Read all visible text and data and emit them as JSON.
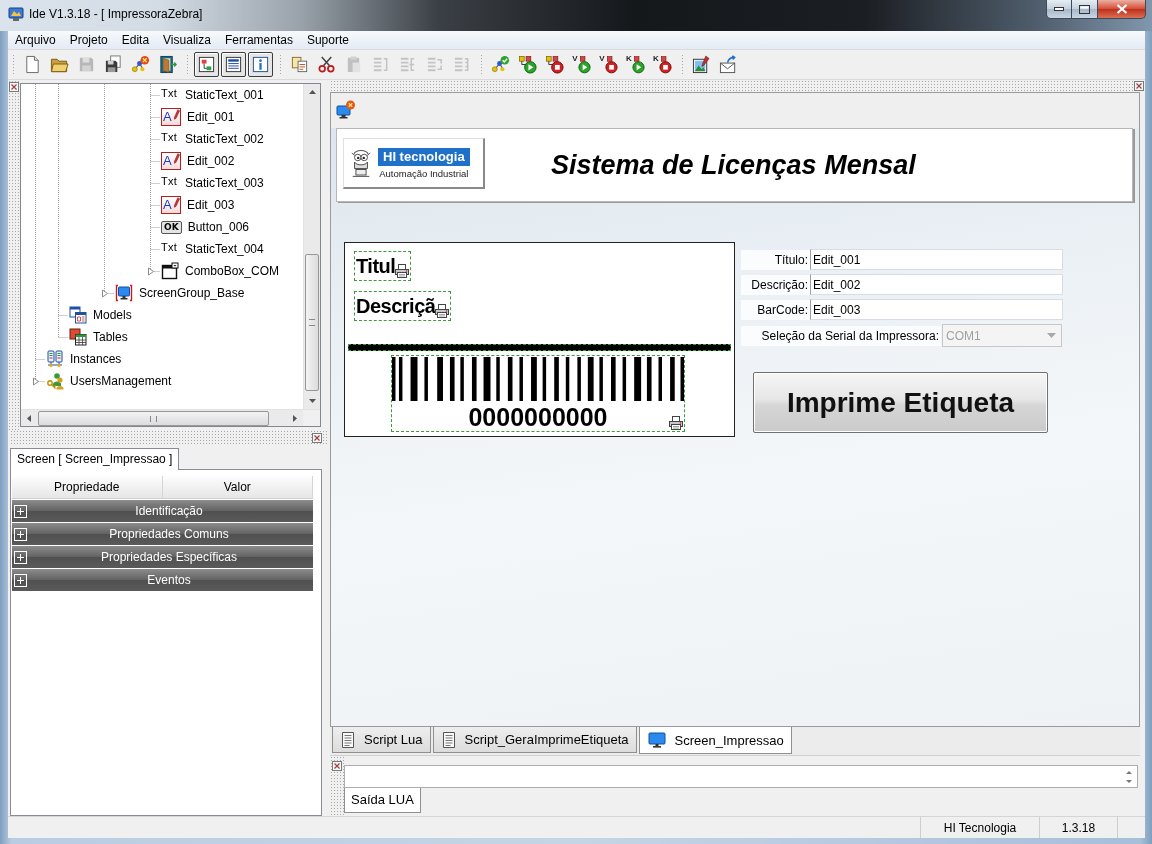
{
  "window": {
    "title": "Ide V1.3.18 - [ ImpressoraZebra]"
  },
  "menu": [
    {
      "label": "Arquivo"
    },
    {
      "label": "Projeto"
    },
    {
      "label": "Edita"
    },
    {
      "label": "Visualiza"
    },
    {
      "label": "Ferramentas"
    },
    {
      "label": "Suporte"
    }
  ],
  "toolbar": [
    {
      "buttons": [
        {
          "kind": "new",
          "disabled": false
        },
        {
          "kind": "open",
          "disabled": false
        },
        {
          "kind": "save",
          "disabled": true
        },
        {
          "kind": "save_all",
          "disabled": false
        },
        {
          "kind": "build",
          "disabled": false
        },
        {
          "kind": "exit",
          "disabled": false
        }
      ]
    },
    {
      "buttons": [
        {
          "kind": "tree_view",
          "pressed": true
        },
        {
          "kind": "list_view",
          "pressed": true
        },
        {
          "kind": "info",
          "pressed": true
        }
      ]
    },
    {
      "buttons": [
        {
          "kind": "copy",
          "disabled": false
        },
        {
          "kind": "cut",
          "disabled": false
        },
        {
          "kind": "paste",
          "disabled": true
        },
        {
          "kind": "align_a",
          "disabled": true
        },
        {
          "kind": "align_b",
          "disabled": true
        },
        {
          "kind": "align_c",
          "disabled": true
        },
        {
          "kind": "align_d",
          "disabled": true
        }
      ]
    },
    {
      "buttons": [
        {
          "kind": "check"
        },
        {
          "kind": "run"
        },
        {
          "kind": "stop"
        },
        {
          "kind": "run_mode",
          "badge": "V"
        },
        {
          "kind": "stop_mode",
          "badge": "V"
        },
        {
          "kind": "run_mode",
          "badge": "K"
        },
        {
          "kind": "stop_mode",
          "badge": "K"
        }
      ]
    },
    {
      "buttons": [
        {
          "kind": "image"
        },
        {
          "kind": "mail"
        }
      ]
    }
  ],
  "project_tree": {
    "items": [
      {
        "children": [
          {
            "children": [
              {
                "children": [
                  {
                    "children": [
                      {
                        "children": [
                          {
                            "label": "StaticText_001",
                            "kind": "static_text",
                            "icon_text": "Txt"
                          },
                          {
                            "label": "Edit_001",
                            "kind": "edit",
                            "icon_text": "A"
                          },
                          {
                            "label": "StaticText_002",
                            "kind": "static_text",
                            "icon_text": "Txt"
                          },
                          {
                            "label": "Edit_002",
                            "kind": "edit",
                            "icon_text": "A"
                          },
                          {
                            "label": "StaticText_003",
                            "kind": "static_text",
                            "icon_text": "Txt"
                          },
                          {
                            "label": "Edit_003",
                            "kind": "edit",
                            "icon_text": "A"
                          },
                          {
                            "label": "Button_006",
                            "kind": "button",
                            "icon_text": "OK"
                          },
                          {
                            "label": "StaticText_004",
                            "kind": "static_text",
                            "icon_text": "Txt"
                          },
                          {
                            "label": "ComboBox_COM",
                            "kind": "combobox",
                            "expanded": false
                          }
                        ]
                      }
                    ]
                  },
                  {
                    "label": "ScreenGroup_Base",
                    "kind": "screen_group",
                    "expanded": false
                  }
                ]
              }
            ]
          },
          {
            "label": "Models",
            "kind": "models"
          },
          {
            "label": "Tables",
            "kind": "tables"
          }
        ]
      },
      {
        "label": "Instances",
        "kind": "instances"
      },
      {
        "label": "UsersManagement",
        "kind": "users",
        "expanded": false
      }
    ]
  },
  "properties": {
    "tabs": [
      {
        "label": "Screen [ Screen_Impressao ]",
        "selected": true
      }
    ],
    "columns": [
      "Propriedade",
      "Valor"
    ],
    "categories": [
      {
        "label": "Identificação",
        "expanded": false
      },
      {
        "label": "Propriedades Comuns",
        "expanded": false
      },
      {
        "label": "Propriedades Específicas",
        "expanded": false
      },
      {
        "label": "Eventos",
        "expanded": false
      }
    ]
  },
  "designer": {
    "header": {
      "logo": {
        "brand": "HI tecnologia",
        "tagline": "Automação Industrial"
      },
      "title": "Sistema de Licenças Mensal"
    },
    "label_preview": {
      "texts": [
        "Titul",
        "Descriçã"
      ],
      "barcode": "0000000000"
    },
    "form": {
      "fields": [
        {
          "kind": "edit",
          "label": "Título:",
          "value": "Edit_001",
          "disabled": false
        },
        {
          "kind": "edit",
          "label": "Descrição:",
          "value": "Edit_002",
          "disabled": false
        },
        {
          "kind": "edit",
          "label": "BarCode:",
          "value": "Edit_003",
          "disabled": false
        },
        {
          "kind": "combo",
          "label": "Seleção da Serial da Impressora:",
          "value": "COM1",
          "disabled": true
        }
      ]
    },
    "print_button": {
      "label": "Imprime Etiqueta"
    }
  },
  "document_tabs": [
    {
      "label": "Script Lua",
      "kind": "script",
      "selected": false
    },
    {
      "label": "Script_GeraImprimeEtiqueta",
      "kind": "script",
      "selected": false
    },
    {
      "label": "Screen_Impressao",
      "kind": "screen",
      "selected": true
    }
  ],
  "output": {
    "tabs": [
      {
        "label": "Saída LUA",
        "selected": true
      }
    ]
  },
  "status_bar": [
    {
      "text": "HI Tecnologia"
    },
    {
      "text": "1.3.18"
    }
  ]
}
